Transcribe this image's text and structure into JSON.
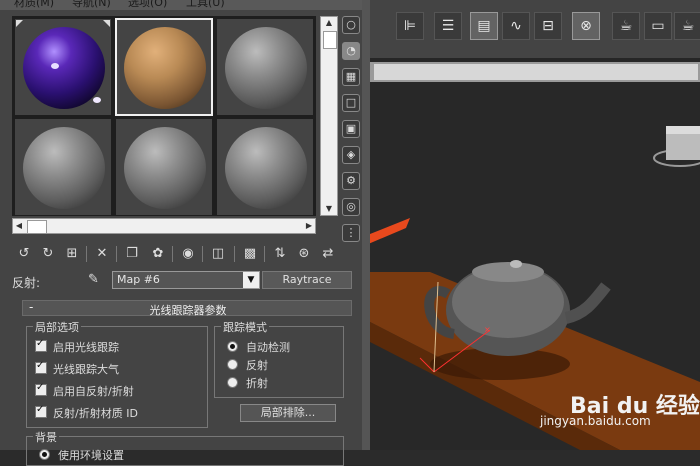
{
  "menu": {
    "items": [
      "材质(M)",
      "导航(N)",
      "选项(O)",
      "工具(U)"
    ]
  },
  "slots": [
    {
      "type": "purple-glossy"
    },
    {
      "type": "wood"
    },
    {
      "type": "gray"
    },
    {
      "type": "gray"
    },
    {
      "type": "gray"
    },
    {
      "type": "gray"
    }
  ],
  "reflect": {
    "label": "反射:",
    "map_value": "Map #6",
    "raytrace_label": "Raytrace"
  },
  "rollout": {
    "collapse_symbol": "-",
    "title": "光线跟踪器参数",
    "local_options": {
      "title": "局部选项",
      "items": [
        {
          "label": "启用光线跟踪",
          "checked": true
        },
        {
          "label": "光线跟踪大气",
          "checked": true
        },
        {
          "label": "启用自反射/折射",
          "checked": true
        },
        {
          "label": "反射/折射材质 ID",
          "checked": true
        }
      ]
    },
    "trace_mode": {
      "title": "跟踪模式",
      "items": [
        {
          "label": "自动检测",
          "selected": true
        },
        {
          "label": "反射",
          "selected": false
        },
        {
          "label": "折射",
          "selected": false
        }
      ]
    },
    "local_exclude_label": "局部排除...",
    "background_title": "背景",
    "background_option": "使用环境设置"
  },
  "watermark": {
    "brand": "Bai du 经验",
    "url": "jingyan.baidu.com"
  },
  "colors": {
    "panel": "#444444",
    "arrow": "#e8491d",
    "floor": "#7a3a10"
  }
}
